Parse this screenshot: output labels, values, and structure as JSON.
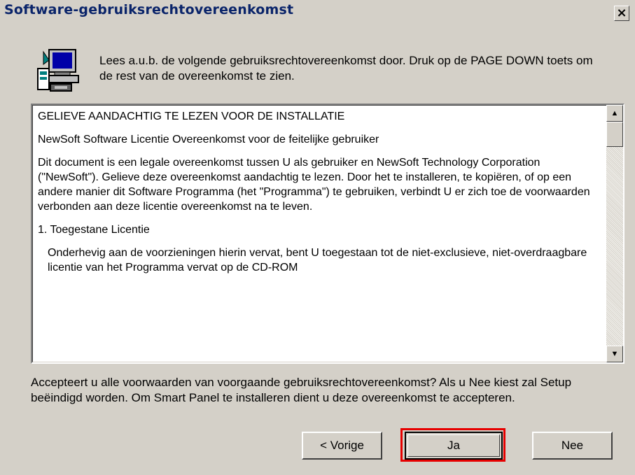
{
  "window": {
    "title": "Software-gebruiksrechtovereenkomst",
    "close_label": "×"
  },
  "header": {
    "icon": "computer-setup-icon",
    "intro_text": "Lees a.u.b. de volgende gebruiksrechtovereenkomst door. Druk op de PAGE DOWN  toets om de rest van de overeenkomst te zien."
  },
  "license": {
    "paragraphs": [
      "GELIEVE AANDACHTIG TE LEZEN VOOR DE INSTALLATIE",
      "NewSoft Software Licentie Overeenkomst voor de feitelijke gebruiker",
      "Dit document is een legale overeenkomst tussen U als gebruiker en NewSoft Technology Corporation (\"NewSoft\"). Gelieve deze overeenkomst aandachtig te lezen. Door het te installeren, te kopiëren, of op een andere manier dit Software Programma (het \"Programma\") te gebruiken, verbindt U er zich toe de voorwaarden verbonden aan deze licentie overeenkomst na te leven.",
      "1. Toegestane Licentie",
      "Onderhevig aan de voorzieningen hierin vervat, bent U toegestaan tot de niet-exclusieve, niet-overdraagbare licentie van het Programma vervat op de CD-ROM"
    ],
    "scroll_up_icon": "▲",
    "scroll_down_icon": "▼"
  },
  "question": "Accepteert u alle voorwaarden van voorgaande gebruiksrechtovereenkomst? Als u Nee kiest zal Setup beëindigd worden. Om Smart Panel te installeren dient u deze overeenkomst te accepteren.",
  "buttons": {
    "back": "< Vorige",
    "yes": "Ja",
    "no": "Nee"
  },
  "colors": {
    "title_text": "#0a246a",
    "dialog_bg": "#d4d0c8",
    "highlight": "#e60000"
  }
}
